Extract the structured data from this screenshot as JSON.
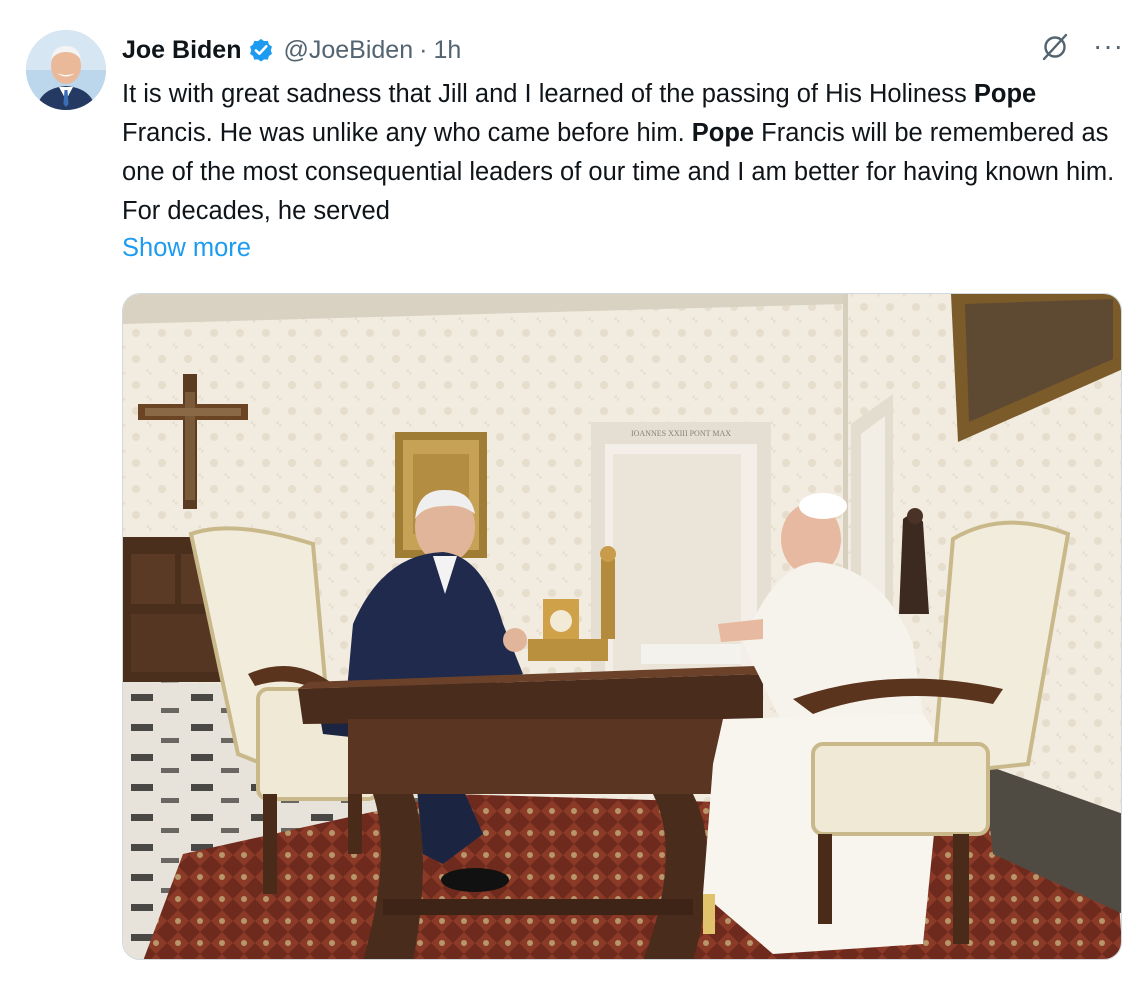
{
  "tweet": {
    "author_name": "Joe Biden",
    "handle": "@JoeBiden",
    "separator": "·",
    "time": "1h",
    "text_line1": "It is with great sadness that Jill and I learned of the passing of His Holiness ",
    "bold1": "Pope",
    "text_line2": " Francis. He was unlike any who came before him. ",
    "bold2": "Pope",
    "text_line3": " Francis will be remembered as one of the most consequential leaders of our time and I am better for having known him. For decades, he served",
    "show_more": "Show more",
    "more_icon": "···"
  },
  "icons": {
    "verified": "verified-badge-icon",
    "grok": "grok-icon",
    "more": "more-options-icon"
  },
  "colors": {
    "accent": "#1d9bf0",
    "text": "#0f1419",
    "secondary": "#536471"
  },
  "photo": {
    "plaque_text": "IOANNES XXIII PONT MAX"
  }
}
